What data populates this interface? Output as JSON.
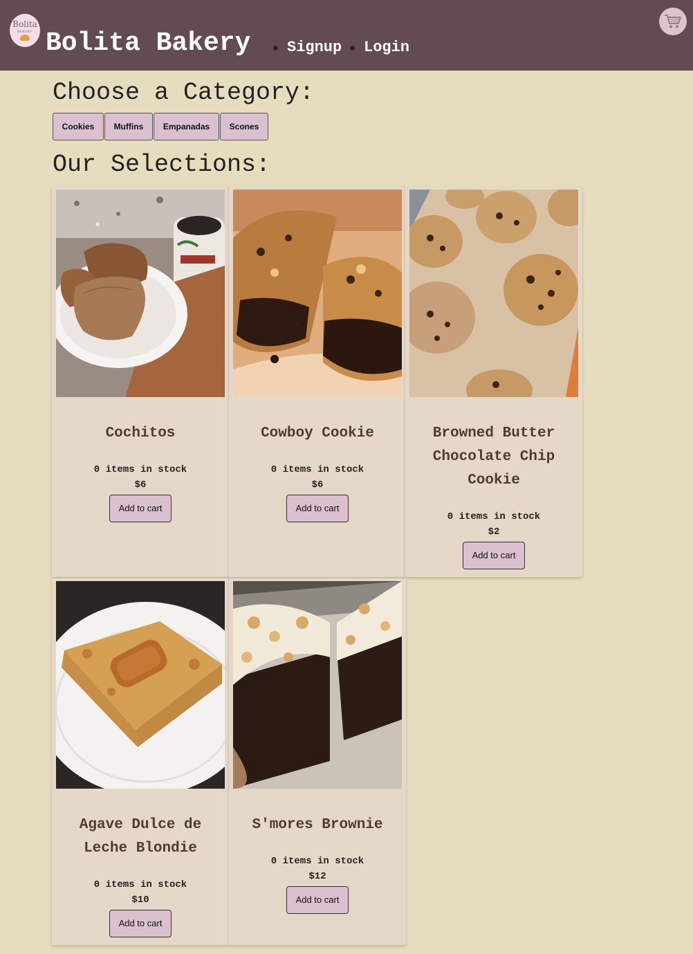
{
  "header": {
    "logo_text": "Bolita",
    "logo_sub": "BAKERY",
    "title": "Bolita Bakery",
    "nav": [
      {
        "label": "Signup"
      },
      {
        "label": "Login"
      }
    ],
    "cart_icon": "shopping-cart-icon"
  },
  "categories": {
    "heading": "Choose a Category:",
    "items": [
      {
        "label": "Cookies"
      },
      {
        "label": "Muffins"
      },
      {
        "label": "Empanadas"
      },
      {
        "label": "Scones"
      }
    ]
  },
  "selections": {
    "heading": "Our Selections:",
    "products": [
      {
        "name": "Cochitos",
        "stock": "0 items in stock",
        "price": "$6",
        "button": "Add to cart"
      },
      {
        "name": "Cowboy Cookie",
        "stock": "0 items in stock",
        "price": "$6",
        "button": "Add to cart"
      },
      {
        "name": "Browned Butter Chocolate Chip Cookie",
        "stock": "0 items in stock",
        "price": "$2",
        "button": "Add to cart"
      },
      {
        "name": "Agave Dulce de Leche Blondie",
        "stock": "0 items in stock",
        "price": "$10",
        "button": "Add to cart"
      },
      {
        "name": "S'mores Brownie",
        "stock": "0 items in stock",
        "price": "$12",
        "button": "Add to cart"
      }
    ]
  },
  "colors": {
    "header_bg": "#634b52",
    "page_bg": "#e6ddbf",
    "card_bg": "#e5d8c9",
    "button_bg": "#dbc0cf",
    "title_text": "#4e3b36"
  }
}
